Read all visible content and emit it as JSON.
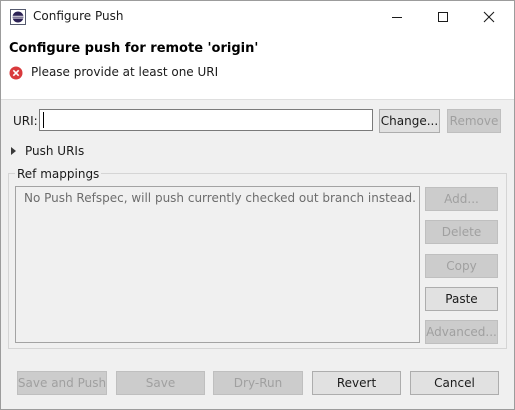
{
  "window": {
    "title": "Configure Push"
  },
  "header": {
    "title": "Configure push for remote 'origin'",
    "error_message": "Please provide at least one URI"
  },
  "uri": {
    "label": "URI:",
    "value": "",
    "change_label": "Change...",
    "remove_label": "Remove"
  },
  "push_uris": {
    "label": "Push URIs"
  },
  "ref_mappings": {
    "label": "Ref mappings",
    "placeholder": "No Push Refspec, will push currently checked out branch instead.",
    "add_label": "Add...",
    "delete_label": "Delete",
    "copy_label": "Copy",
    "paste_label": "Paste",
    "advanced_label": "Advanced..."
  },
  "footer": {
    "save_and_push_label": "Save and Push",
    "save_label": "Save",
    "dry_run_label": "Dry-Run",
    "revert_label": "Revert",
    "cancel_label": "Cancel"
  },
  "colors": {
    "error": "#d9393c",
    "window_bg": "#f0f0f0",
    "header_bg": "#ffffff"
  }
}
